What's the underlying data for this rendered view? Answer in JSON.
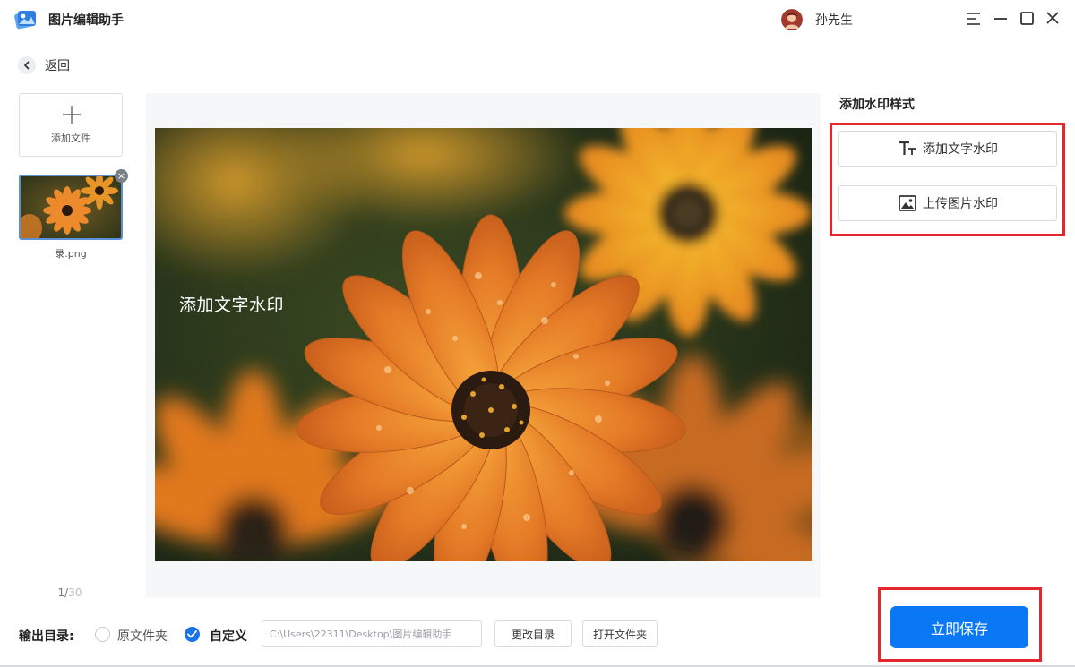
{
  "app": {
    "title": "图片编辑助手",
    "user_name": "孙先生"
  },
  "nav": {
    "back_label": "返回"
  },
  "files": {
    "add_label": "添加文件",
    "items": [
      {
        "name": "录.png",
        "selected": true
      }
    ],
    "current_page": "1/",
    "total_pages": "30"
  },
  "preview": {
    "watermark_text": "添加文字水印"
  },
  "watermark_panel": {
    "title": "添加水印样式",
    "add_text_label": "添加文字水印",
    "upload_image_label": "上传图片水印"
  },
  "output": {
    "label": "输出目录:",
    "option_original": "原文件夹",
    "option_custom": "自定义",
    "selected": "自定义",
    "path_value": "C:\\Users\\22311\\Desktop\\图片编辑助手",
    "change_dir_label": "更改目录",
    "open_folder_label": "打开文件夹",
    "save_label": "立即保存"
  },
  "colors": {
    "accent": "#0a77f5",
    "highlight": "#e5262c",
    "radio_checked": "#1a73e8"
  },
  "icons": [
    "app-logo-icon",
    "menu-icon",
    "minimize-icon",
    "maximize-icon",
    "close-icon",
    "back-chevron-icon",
    "plus-icon",
    "remove-icon",
    "text-watermark-icon",
    "image-watermark-icon",
    "check-icon"
  ]
}
